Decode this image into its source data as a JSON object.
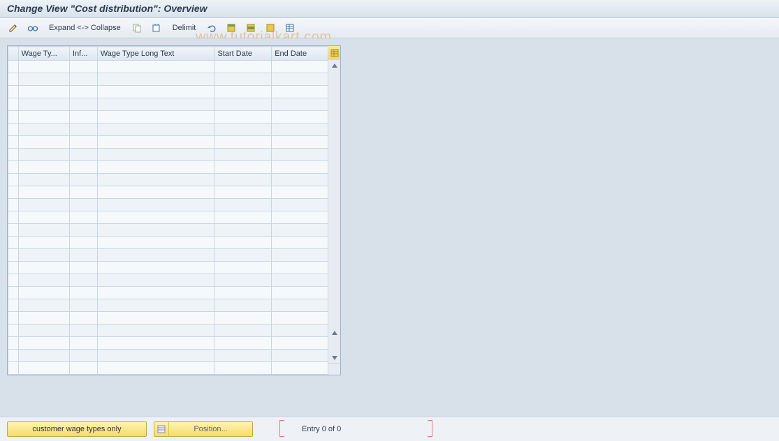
{
  "title": "Change View \"Cost distribution\": Overview",
  "watermark": "www.tutorialkart.com",
  "toolbar": {
    "expand_collapse_label": "Expand <-> Collapse",
    "delimit_label": "Delimit"
  },
  "table": {
    "columns": {
      "wage_type": "Wage Ty...",
      "infotype": "Inf...",
      "wage_type_long_text": "Wage Type Long Text",
      "start_date": "Start Date",
      "end_date": "End Date"
    },
    "row_count": 25
  },
  "footer": {
    "customer_wage_types_label": "customer wage types only",
    "position_label": "Position...",
    "entry_text": "Entry 0 of 0"
  }
}
